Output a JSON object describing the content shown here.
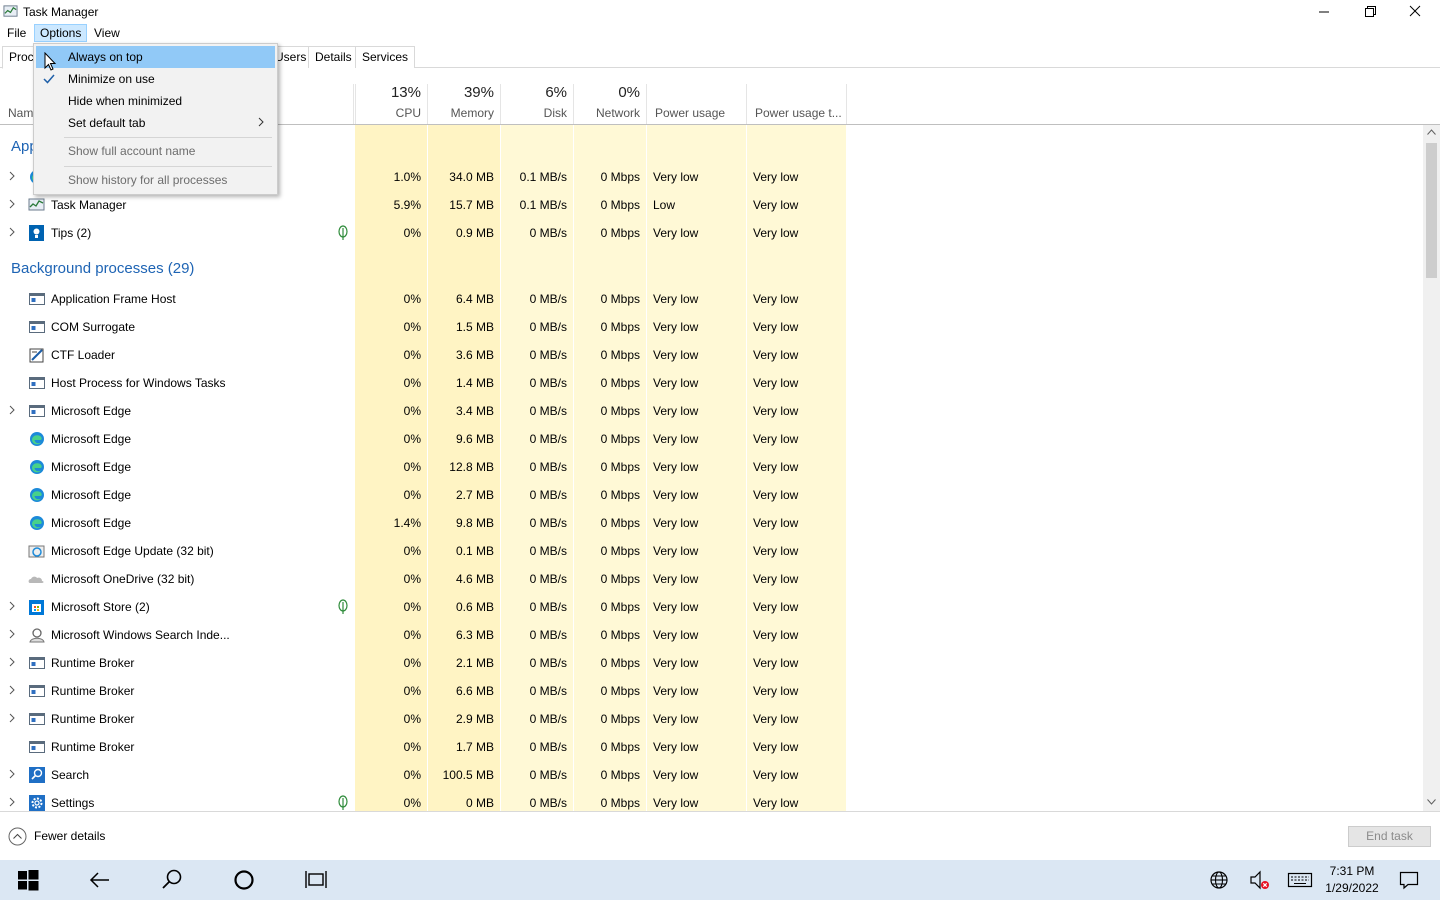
{
  "window": {
    "title": "Task Manager"
  },
  "menubar": {
    "file": "File",
    "options": "Options",
    "view": "View"
  },
  "tabs": {
    "processes": "Proc",
    "users": "Users",
    "details": "Details",
    "services": "Services"
  },
  "columns": {
    "name": "Name",
    "cpu": {
      "pct": "13%",
      "label": "CPU"
    },
    "memory": {
      "pct": "39%",
      "label": "Memory"
    },
    "disk": {
      "pct": "6%",
      "label": "Disk"
    },
    "network": {
      "pct": "0%",
      "label": "Network"
    },
    "power": {
      "label": "Power usage"
    },
    "power_trend": {
      "label": "Power usage t..."
    }
  },
  "options_menu": {
    "always_on_top": "Always on top",
    "minimize_on_use": "Minimize on use",
    "hide_when_minimized": "Hide when minimized",
    "set_default_tab": "Set default tab",
    "show_full_account_name": "Show full account name",
    "show_history": "Show history for all processes"
  },
  "groups": {
    "apps": "Apps",
    "background": "Background processes (29)"
  },
  "app_rows": [
    {
      "name": "",
      "cpu": "1.0%",
      "mem": "34.0 MB",
      "disk": "0.1 MB/s",
      "net": "0 Mbps",
      "power": "Very low",
      "trend": "Very low"
    },
    {
      "name": "Task Manager",
      "cpu": "5.9%",
      "mem": "15.7 MB",
      "disk": "0.1 MB/s",
      "net": "0 Mbps",
      "power": "Low",
      "trend": "Very low"
    },
    {
      "name": "Tips (2)",
      "cpu": "0%",
      "mem": "0.9 MB",
      "disk": "0 MB/s",
      "net": "0 Mbps",
      "power": "Very low",
      "trend": "Very low"
    }
  ],
  "bg_rows": [
    {
      "name": "Application Frame Host",
      "cpu": "0%",
      "mem": "6.4 MB",
      "disk": "0 MB/s",
      "net": "0 Mbps",
      "power": "Very low",
      "trend": "Very low"
    },
    {
      "name": "COM Surrogate",
      "cpu": "0%",
      "mem": "1.5 MB",
      "disk": "0 MB/s",
      "net": "0 Mbps",
      "power": "Very low",
      "trend": "Very low"
    },
    {
      "name": "CTF Loader",
      "cpu": "0%",
      "mem": "3.6 MB",
      "disk": "0 MB/s",
      "net": "0 Mbps",
      "power": "Very low",
      "trend": "Very low"
    },
    {
      "name": "Host Process for Windows Tasks",
      "cpu": "0%",
      "mem": "1.4 MB",
      "disk": "0 MB/s",
      "net": "0 Mbps",
      "power": "Very low",
      "trend": "Very low"
    },
    {
      "name": "Microsoft Edge",
      "cpu": "0%",
      "mem": "3.4 MB",
      "disk": "0 MB/s",
      "net": "0 Mbps",
      "power": "Very low",
      "trend": "Very low"
    },
    {
      "name": "Microsoft Edge",
      "cpu": "0%",
      "mem": "9.6 MB",
      "disk": "0 MB/s",
      "net": "0 Mbps",
      "power": "Very low",
      "trend": "Very low"
    },
    {
      "name": "Microsoft Edge",
      "cpu": "0%",
      "mem": "12.8 MB",
      "disk": "0 MB/s",
      "net": "0 Mbps",
      "power": "Very low",
      "trend": "Very low"
    },
    {
      "name": "Microsoft Edge",
      "cpu": "0%",
      "mem": "2.7 MB",
      "disk": "0 MB/s",
      "net": "0 Mbps",
      "power": "Very low",
      "trend": "Very low"
    },
    {
      "name": "Microsoft Edge",
      "cpu": "1.4%",
      "mem": "9.8 MB",
      "disk": "0 MB/s",
      "net": "0 Mbps",
      "power": "Very low",
      "trend": "Very low"
    },
    {
      "name": "Microsoft Edge Update (32 bit)",
      "cpu": "0%",
      "mem": "0.1 MB",
      "disk": "0 MB/s",
      "net": "0 Mbps",
      "power": "Very low",
      "trend": "Very low"
    },
    {
      "name": "Microsoft OneDrive (32 bit)",
      "cpu": "0%",
      "mem": "4.6 MB",
      "disk": "0 MB/s",
      "net": "0 Mbps",
      "power": "Very low",
      "trend": "Very low"
    },
    {
      "name": "Microsoft Store (2)",
      "cpu": "0%",
      "mem": "0.6 MB",
      "disk": "0 MB/s",
      "net": "0 Mbps",
      "power": "Very low",
      "trend": "Very low"
    },
    {
      "name": "Microsoft Windows Search Inde...",
      "cpu": "0%",
      "mem": "6.3 MB",
      "disk": "0 MB/s",
      "net": "0 Mbps",
      "power": "Very low",
      "trend": "Very low"
    },
    {
      "name": "Runtime Broker",
      "cpu": "0%",
      "mem": "2.1 MB",
      "disk": "0 MB/s",
      "net": "0 Mbps",
      "power": "Very low",
      "trend": "Very low"
    },
    {
      "name": "Runtime Broker",
      "cpu": "0%",
      "mem": "6.6 MB",
      "disk": "0 MB/s",
      "net": "0 Mbps",
      "power": "Very low",
      "trend": "Very low"
    },
    {
      "name": "Runtime Broker",
      "cpu": "0%",
      "mem": "2.9 MB",
      "disk": "0 MB/s",
      "net": "0 Mbps",
      "power": "Very low",
      "trend": "Very low"
    },
    {
      "name": "Runtime Broker",
      "cpu": "0%",
      "mem": "1.7 MB",
      "disk": "0 MB/s",
      "net": "0 Mbps",
      "power": "Very low",
      "trend": "Very low"
    },
    {
      "name": "Search",
      "cpu": "0%",
      "mem": "100.5 MB",
      "disk": "0 MB/s",
      "net": "0 Mbps",
      "power": "Very low",
      "trend": "Very low"
    },
    {
      "name": "Settings",
      "cpu": "0%",
      "mem": "0 MB",
      "disk": "0 MB/s",
      "net": "0 Mbps",
      "power": "Very low",
      "trend": "Very low"
    }
  ],
  "footer": {
    "fewer_details": "Fewer details",
    "end_task": "End task"
  },
  "taskbar": {
    "time": "7:31 PM",
    "date": "1/29/2022"
  },
  "colors": {
    "heat_light": "#fff9d6",
    "heat_medium": "#fff4c4",
    "accent": "#1e64b4",
    "menu_highlight": "#91c9f7"
  }
}
